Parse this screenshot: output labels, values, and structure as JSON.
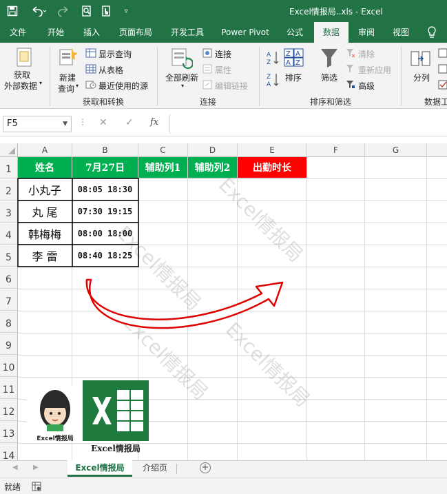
{
  "window": {
    "title": "Excel情报局..xls  -  Excel"
  },
  "quick_access": {
    "save_icon": "save-icon",
    "undo_icon": "undo-icon",
    "redo_icon": "redo-icon",
    "preview_icon": "print-preview-icon",
    "touch_icon": "touch-mode-icon",
    "customize_icon": "customize-dropdown-icon"
  },
  "tabs": [
    "文件",
    "开始",
    "插入",
    "页面布局",
    "开发工具",
    "Power Pivot",
    "公式",
    "数据",
    "审阅",
    "视图"
  ],
  "active_tab": "数据",
  "ribbon": {
    "get_data": {
      "line1": "获取",
      "line2": "外部数据"
    },
    "new_query": {
      "line1": "新建",
      "line2": "查询"
    },
    "show_queries": "显示查询",
    "from_table": "从表格",
    "recent_sources": "最近使用的源",
    "group_get_transform": "获取和转换",
    "refresh_all": "全部刷新",
    "connections": "连接",
    "properties": "属性",
    "edit_links": "编辑链接",
    "group_connections": "连接",
    "sort": "排序",
    "filter": "筛选",
    "clear": "清除",
    "reapply": "重新应用",
    "advanced": "高级",
    "group_sort_filter": "排序和筛选",
    "text_to_columns": "分列",
    "group_data_tools": "数据工"
  },
  "formula_bar": {
    "name_box": "F5",
    "cancel": "✕",
    "enter": "✓",
    "fx": "fx",
    "value": ""
  },
  "columns": [
    "A",
    "B",
    "C",
    "D",
    "E",
    "F",
    "G"
  ],
  "rows": [
    "1",
    "2",
    "3",
    "4",
    "5",
    "6",
    "7",
    "8",
    "9",
    "10",
    "11",
    "12",
    "13",
    "14"
  ],
  "table": {
    "header_name": "姓名",
    "header_date": "7月27日",
    "helper1": "辅助列1",
    "helper2": "辅助列2",
    "duration": "出勤时长",
    "records": [
      {
        "name": "小丸子",
        "time": "08:05 18:30"
      },
      {
        "name": "丸  尾",
        "time": "07:30 19:15"
      },
      {
        "name": "韩梅梅",
        "time": "08:00 18:00"
      },
      {
        "name": "李  雷",
        "time": "08:40 18:25"
      }
    ]
  },
  "watermark": "Excel情报局",
  "logo_caption": "Excel情报局",
  "sheets": [
    "Excel情报局",
    "介绍页"
  ],
  "active_sheet": "Excel情报局",
  "status": {
    "ready": "就绪"
  },
  "colors": {
    "excel_green": "#217346",
    "header_green": "#00b050",
    "header_red": "#ff0000",
    "arrow_red": "#e00000"
  }
}
